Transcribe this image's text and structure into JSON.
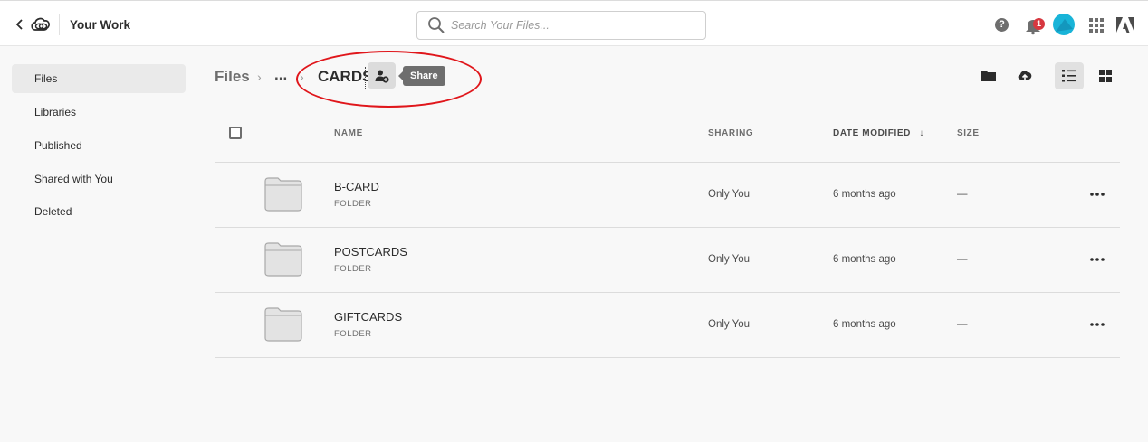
{
  "header": {
    "title": "Your Work",
    "search": {
      "placeholder": "Search Your Files...",
      "value": ""
    },
    "notification_count": "1",
    "help_glyph": "?"
  },
  "sidebar": {
    "items": [
      {
        "label": "Files",
        "active": true
      },
      {
        "label": "Libraries",
        "active": false
      },
      {
        "label": "Published",
        "active": false
      },
      {
        "label": "Shared with You",
        "active": false
      },
      {
        "label": "Deleted",
        "active": false
      }
    ]
  },
  "breadcrumb": {
    "root": "Files",
    "separator": "›",
    "ellipsis": "...",
    "current": "CARDS",
    "share_tooltip": "Share"
  },
  "toolbar": {
    "buttons": [
      "new-folder-icon",
      "upload-cloud-icon",
      "list-view-icon",
      "grid-view-icon"
    ],
    "selected_view": "list"
  },
  "table": {
    "columns": {
      "name": "NAME",
      "sharing": "SHARING",
      "modified": "DATE MODIFIED",
      "sort_arrow": "↓",
      "size": "SIZE"
    },
    "rows": [
      {
        "name": "B-CARD",
        "kind": "FOLDER",
        "sharing": "Only You",
        "modified": "6 months ago",
        "size": "—"
      },
      {
        "name": "POSTCARDS",
        "kind": "FOLDER",
        "sharing": "Only You",
        "modified": "6 months ago",
        "size": "—"
      },
      {
        "name": "GIFTCARDS",
        "kind": "FOLDER",
        "sharing": "Only You",
        "modified": "6 months ago",
        "size": "—"
      }
    ]
  },
  "colors": {
    "accent_avatar": "#19b4d8",
    "badge": "#d7373f",
    "annotation_ellipse": "#e0161b"
  }
}
